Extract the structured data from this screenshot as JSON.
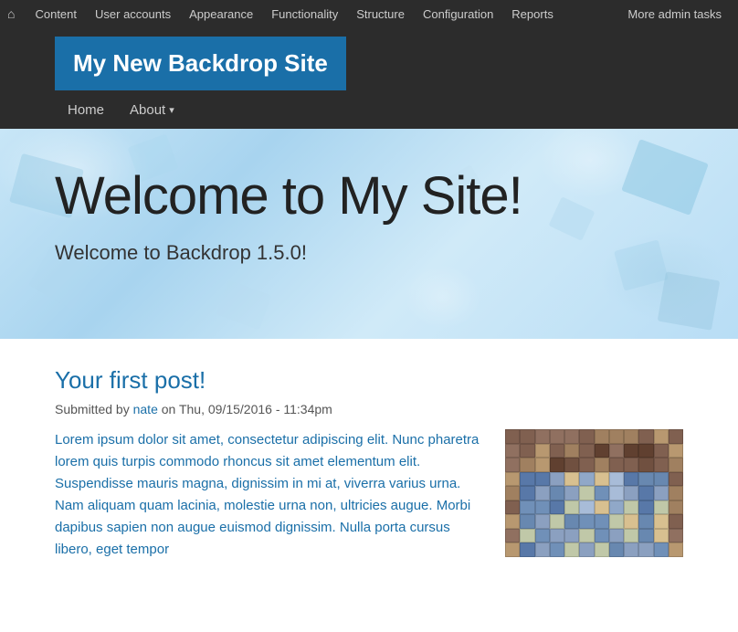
{
  "adminBar": {
    "homeIcon": "⌂",
    "navItems": [
      {
        "label": "Content",
        "id": "content"
      },
      {
        "label": "User accounts",
        "id": "user-accounts"
      },
      {
        "label": "Appearance",
        "id": "appearance"
      },
      {
        "label": "Functionality",
        "id": "functionality"
      },
      {
        "label": "Structure",
        "id": "structure"
      },
      {
        "label": "Configuration",
        "id": "configuration"
      },
      {
        "label": "Reports",
        "id": "reports"
      }
    ],
    "moreAdminLabel": "More admin tasks"
  },
  "siteTitle": "My New Backdrop Site",
  "mainNav": [
    {
      "label": "Home",
      "id": "home",
      "hasDropdown": false
    },
    {
      "label": "About",
      "id": "about",
      "hasDropdown": true
    }
  ],
  "hero": {
    "title": "Welcome to My Site!",
    "subtitle": "Welcome to Backdrop 1.5.0!"
  },
  "post": {
    "title": "Your first post!",
    "meta": {
      "prefix": "Submitted by ",
      "author": "nate",
      "suffix": " on Thu, 09/15/2016 - 11:34pm"
    },
    "body": "Lorem ipsum dolor sit amet, consectetur adipiscing elit. Nunc pharetra lorem quis turpis commodo rhoncus sit amet elementum elit. Suspendisse mauris magna, dignissim in mi at, viverra varius urna. Nam aliquam quam lacinia, molestie urna non, ultricies augue. Morbi dapibus sapien non augue euismod dignissim. Nulla porta cursus libero, eget tempor"
  }
}
